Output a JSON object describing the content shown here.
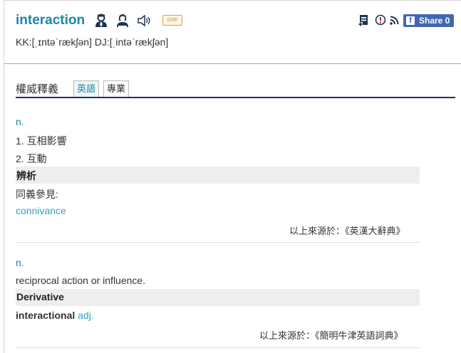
{
  "entry": {
    "word": "interaction",
    "badge": "GRE",
    "phonetic": "KK:[ˌɪntəˈrækʃən] DJ:[ˌintəˈrækʃən]"
  },
  "share": {
    "label": "Share 0",
    "fb_glyph": "f"
  },
  "tabs": {
    "heading": "權威釋義",
    "items": [
      "英語",
      "專業"
    ],
    "active": "英語"
  },
  "sections": [
    {
      "pos": "n.",
      "defs": [
        "1. 互相影響",
        "2. 互動"
      ],
      "note_title": "辨析",
      "note_label": "同義參見:",
      "note_link": "connivance",
      "source": "以上來源於：《英漢大辭典》"
    },
    {
      "pos": "n.",
      "defs": [
        "reciprocal action or influence."
      ],
      "note_title": "Derivative",
      "derivative_word": "interactional",
      "derivative_pos": "adj.",
      "source": "以上來源於：《簡明牛津英語詞典》"
    }
  ],
  "colors": {
    "accent": "#1a87a8",
    "link": "#3a9ec4",
    "share": "#4267b2"
  }
}
